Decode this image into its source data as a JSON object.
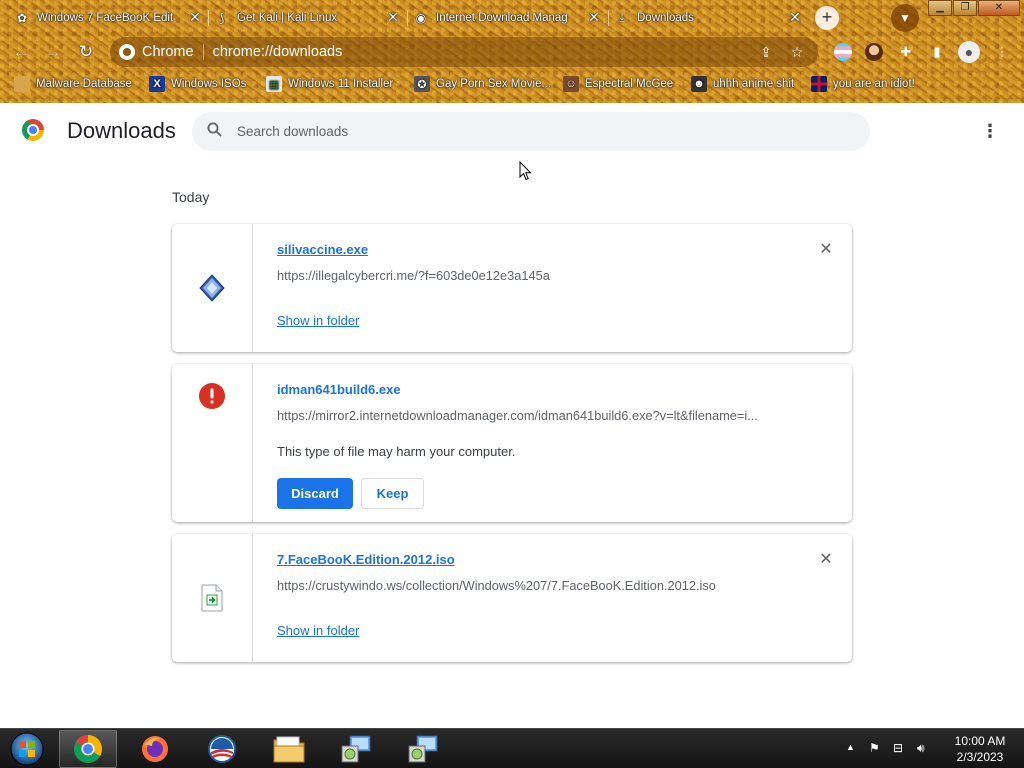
{
  "browser": {
    "tabs": [
      {
        "title": "Windows 7 FaceBooK Edit",
        "icon": "generic-site-icon"
      },
      {
        "title": "Get Kali | Kali Linux",
        "icon": "kali-dragon-icon"
      },
      {
        "title": "Internet Download Manag",
        "icon": "globe-icon"
      },
      {
        "title": "Downloads",
        "icon": "download-icon",
        "active": true
      }
    ],
    "close_glyph": "✕",
    "new_tab_glyph": "+",
    "omnibox": {
      "chip": "Chrome",
      "url": "chrome://downloads"
    },
    "bookmarks": [
      {
        "label": "Malware Database",
        "icon": "folder-icon"
      },
      {
        "label": "Windows ISOs",
        "icon": "x-logo-icon"
      },
      {
        "label": "Windows 11 Installer",
        "icon": "image-icon"
      },
      {
        "label": "Gay Porn Sex Movie...",
        "icon": "badge-icon"
      },
      {
        "label": "Espectral McGee",
        "icon": "avatar-icon"
      },
      {
        "label": "uhhh anime shit",
        "icon": "anime-icon"
      },
      {
        "label": "you are an idiot!",
        "icon": "uk-flag-icon"
      }
    ]
  },
  "page": {
    "title": "Downloads",
    "search_placeholder": "Search downloads",
    "section_date": "Today"
  },
  "downloads": [
    {
      "name": "silivaccine.exe",
      "url": "https://illegalcybercri.me/?f=603de0e12e3a145a",
      "action": "Show in folder",
      "icon": "exe-file-icon"
    },
    {
      "name": "idman641build6.exe",
      "url": "https://mirror2.internetdownloadmanager.com/idman641build6.exe?v=lt&filename=i...",
      "warning": "This type of file may harm your computer.",
      "discard": "Discard",
      "keep": "Keep",
      "icon": "danger-icon"
    },
    {
      "name": "7.FaceBooK.Edition.2012.iso",
      "url": "https://crustywindo.ws/collection/Windows%207/7.FaceBooK.Edition.2012.iso",
      "action": "Show in folder",
      "icon": "iso-file-icon"
    }
  ],
  "taskbar": {
    "time": "10:00 AM",
    "date": "2/3/2023"
  },
  "colors": {
    "accent": "#1a73e8",
    "danger": "#d93025",
    "theme": "#c4861f"
  }
}
